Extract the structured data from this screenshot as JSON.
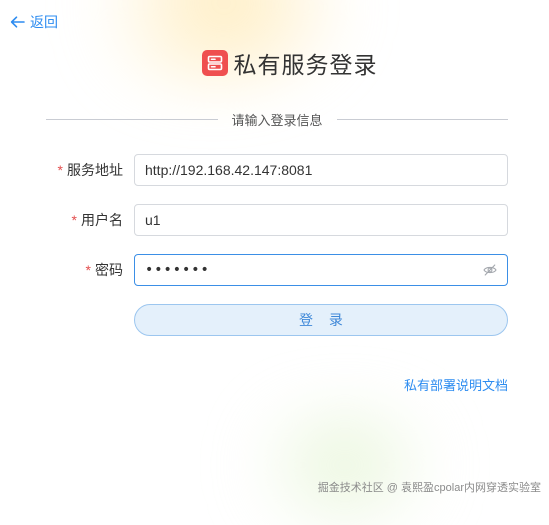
{
  "nav": {
    "back_label": "返回"
  },
  "header": {
    "title": "私有服务登录"
  },
  "form": {
    "section_title": "请输入登录信息",
    "server": {
      "label": "服务地址",
      "value": "http://192.168.42.147:8081",
      "required_mark": "*"
    },
    "username": {
      "label": "用户名",
      "value": "u1",
      "required_mark": "*"
    },
    "password": {
      "label": "密码",
      "value": "•••••••",
      "required_mark": "*"
    },
    "login_label": "登 录"
  },
  "links": {
    "docs_label": "私有部署说明文档"
  },
  "watermark": "掘金技术社区 @ 袁熙盈cpolar内网穿透实验室",
  "colors": {
    "accent": "#2d8cf0",
    "logo": "#ef4f4f",
    "required": "#e34d4d",
    "button_bg": "#e4f0fb"
  },
  "icons": {
    "back": "arrow-left-icon",
    "logo": "server-icon",
    "password_toggle": "eye-off-icon"
  }
}
